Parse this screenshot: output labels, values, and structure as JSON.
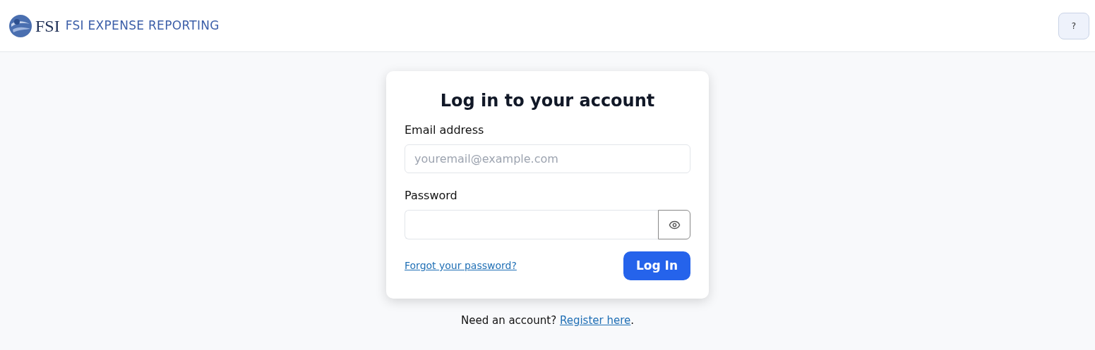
{
  "header": {
    "logo_mark": "FSI",
    "brand": "FSI EXPENSE REPORTING",
    "help_button": "?"
  },
  "login": {
    "title": "Log in to your account",
    "email": {
      "label": "Email address",
      "placeholder": "youremail@example.com"
    },
    "password": {
      "label": "Password",
      "revealed": false
    },
    "forgot_link": "Forgot your password?",
    "submit": "Log In"
  },
  "footer": {
    "text": "Need an account?",
    "link": "Register here",
    "suffix": "."
  }
}
